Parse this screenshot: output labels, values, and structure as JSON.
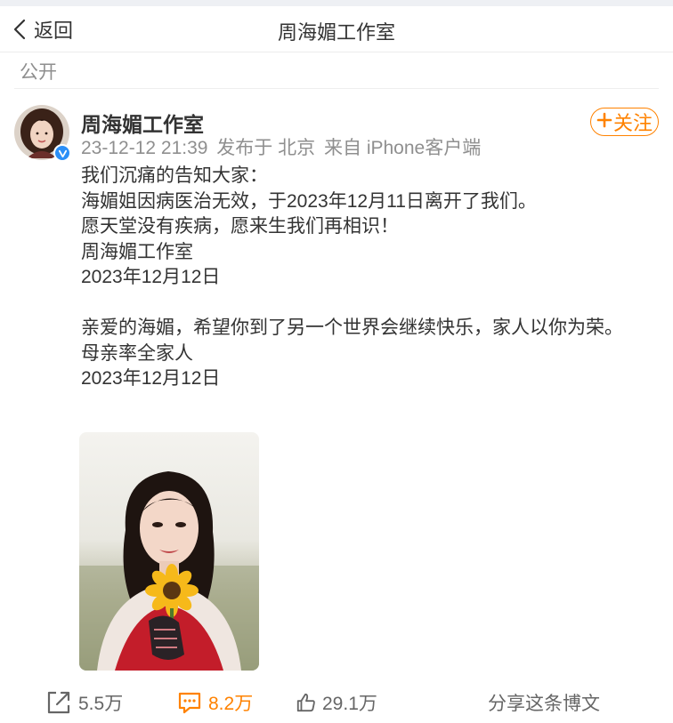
{
  "nav": {
    "back_label": "返回",
    "title": "周海媚工作室"
  },
  "post": {
    "visibility": "公开",
    "author": "周海媚工作室",
    "timestamp": "23-12-12 21:39",
    "location": "发布于 北京",
    "client": "来自 iPhone客户端",
    "follow_label": "关注",
    "content_lines": [
      "我们沉痛的告知大家：",
      "海媚姐因病医治无效，于2023年12月11日离开了我们。",
      "愿天堂没有疾病，愿来生我们再相识！",
      "周海媚工作室",
      "2023年12月12日",
      "",
      "亲爱的海媚，希望你到了另一个世界会继续快乐，家人以你为荣。",
      "母亲率全家人",
      "2023年12月12日"
    ],
    "image_icon": "photo-woman-sunflower"
  },
  "actions": {
    "forward_count": "5.5万",
    "comment_count": "8.2万",
    "like_count": "29.1万",
    "share_label": "分享这条博文"
  },
  "colors": {
    "accent": "#ff8200",
    "muted": "#8f8f8f",
    "verified": "#2b8ff7"
  }
}
